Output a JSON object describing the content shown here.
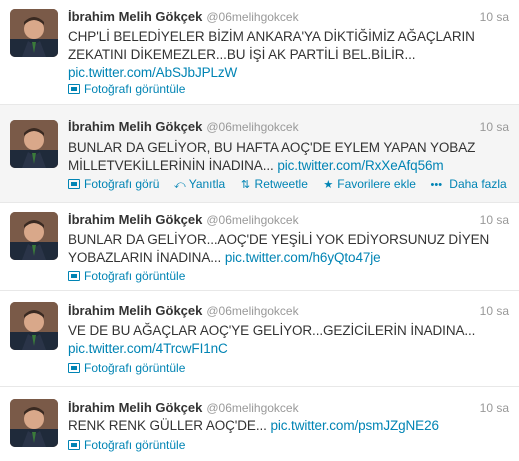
{
  "tweets": [
    {
      "name": "İbrahim Melih Gökçek",
      "handle": "@06melihgokcek",
      "time": "10 sa",
      "text": "CHP'Lİ BELEDİYELER BİZİM ANKARA'YA DİKTİĞİMİZ AĞAÇLARIN ZEKATINI DİKEMEZLER...BU İŞİ AK PARTİLİ BEL.BİLİR...",
      "link": "pic.twitter.com/AbSJbJPLzW",
      "photo_label": "Fotoğrafı görüntüle"
    },
    {
      "name": "İbrahim Melih Gökçek",
      "handle": "@06melihgokcek",
      "time": "10 sa",
      "text": "BUNLAR DA GELİYOR, BU HAFTA AOÇ'DE EYLEM YAPAN YOBAZ MİLLETVEKİLLERİNİN İNADINA...",
      "link": "pic.twitter.com/RxXeAfq56m",
      "photo_label": "Fotoğrafı görü",
      "reply_label": "Yanıtla",
      "retweet_label": "Retweetle",
      "favorite_label": "Favorilere ekle",
      "more_label": "Daha fazla"
    },
    {
      "name": "İbrahim Melih Gökçek",
      "handle": "@06melihgokcek",
      "time": "10 sa",
      "text": "BUNLAR DA GELİYOR...AOÇ'DE YEŞİLİ YOK EDİYORSUNUZ DİYEN YOBAZLARIN İNADINA...",
      "link": "pic.twitter.com/h6yQto47je",
      "photo_label": "Fotoğrafı görüntüle"
    },
    {
      "name": "İbrahim Melih Gökçek",
      "handle": "@06melihgokcek",
      "time": "10 sa",
      "text": "VE DE BU AĞAÇLAR AOÇ'YE GELİYOR...GEZİCİLERİN İNADINA...",
      "link": "pic.twitter.com/4TrcwFI1nC",
      "photo_label": "Fotoğrafı görüntüle"
    },
    {
      "name": "İbrahim Melih Gökçek",
      "handle": "@06melihgokcek",
      "time": "10 sa",
      "text": "RENK RENK GÜLLER AOÇ'DE...",
      "link": "pic.twitter.com/psmJZgNE26",
      "photo_label": "Fotoğrafı görüntüle"
    }
  ],
  "colors": {
    "link": "#0084b4",
    "muted": "#999999",
    "text": "#333333",
    "hover_bg": "#f5f5f5"
  },
  "icons": {
    "photo": "photo-icon",
    "reply": "reply-icon",
    "retweet": "retweet-icon",
    "favorite": "star-icon",
    "more": "more-icon"
  }
}
